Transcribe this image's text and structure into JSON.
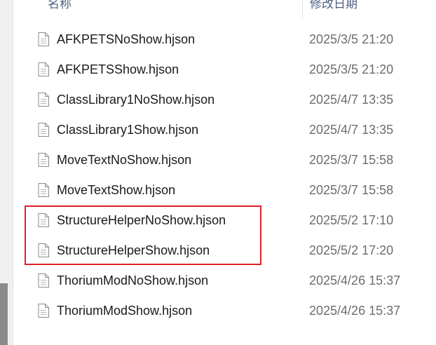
{
  "header": {
    "name_label": "名称",
    "date_label": "修改日期"
  },
  "files": [
    {
      "name": "AFKPETSNoShow.hjson",
      "modified": "2025/3/5 21:20"
    },
    {
      "name": "AFKPETSShow.hjson",
      "modified": "2025/3/5 21:20"
    },
    {
      "name": "ClassLibrary1NoShow.hjson",
      "modified": "2025/4/7 13:35"
    },
    {
      "name": "ClassLibrary1Show.hjson",
      "modified": "2025/4/7 13:35"
    },
    {
      "name": "MoveTextNoShow.hjson",
      "modified": "2025/3/7 15:58"
    },
    {
      "name": "MoveTextShow.hjson",
      "modified": "2025/3/7 15:58"
    },
    {
      "name": "StructureHelperNoShow.hjson",
      "modified": "2025/5/2 17:10"
    },
    {
      "name": "StructureHelperShow.hjson",
      "modified": "2025/5/2 17:20"
    },
    {
      "name": "ThoriumModNoShow.hjson",
      "modified": "2025/4/26 15:37"
    },
    {
      "name": "ThoriumModShow.hjson",
      "modified": "2025/4/26 15:37"
    }
  ],
  "highlight": {
    "color": "#e0202a",
    "highlighted_files": [
      "StructureHelperNoShow.hjson",
      "StructureHelperShow.hjson"
    ]
  },
  "icons": {
    "file": "document-icon"
  }
}
